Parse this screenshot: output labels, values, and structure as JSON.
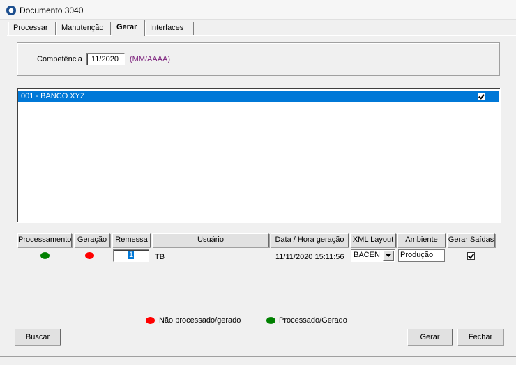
{
  "window": {
    "title": "Documento 3040"
  },
  "tabs": [
    "Processar",
    "Manutenção",
    "Gerar",
    "Interfaces"
  ],
  "competencia": {
    "label": "Competência",
    "value": "11/2020",
    "hint": "(MM/AAAA)"
  },
  "list": {
    "items": [
      {
        "label": "001 - BANCO XYZ",
        "checked": true
      }
    ]
  },
  "grid": {
    "headers": [
      "Processamento",
      "Geração",
      "Remessa",
      "Usuário",
      "Data / Hora geração",
      "XML Layout",
      "Ambiente",
      "Gerar Saídas"
    ],
    "row": {
      "processamento_status": "green",
      "geracao_status": "red",
      "remessa": "1",
      "usuario": "TB",
      "data_hora": "11/11/2020 15:11:56",
      "xml_layout": "BACEN",
      "ambiente": "Produção",
      "gerar_saidas": true
    }
  },
  "legend": {
    "red_label": "Não processado/gerado",
    "green_label": "Processado/Gerado"
  },
  "buttons": {
    "buscar": "Buscar",
    "gerar": "Gerar",
    "fechar": "Fechar"
  },
  "colors": {
    "red": "#ff0000",
    "green": "#008000",
    "selection": "#0078d7",
    "hint": "#7a1d7a"
  }
}
